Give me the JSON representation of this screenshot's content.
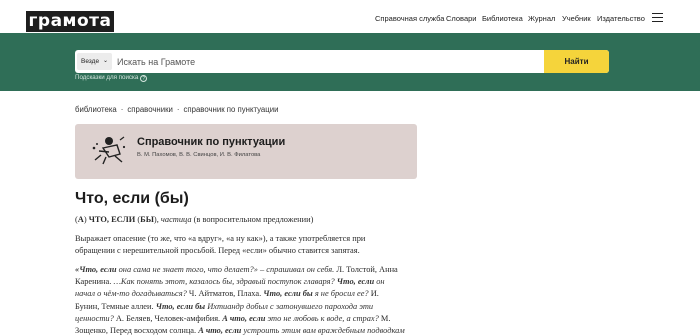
{
  "header": {
    "logo": "грамота",
    "nav": [
      "Справочная служба",
      "Словари",
      "Библиотека",
      "Журнал",
      "Учебник",
      "Издательство"
    ]
  },
  "search": {
    "scope": "Везде",
    "placeholder": "Искать на Грамоте",
    "button": "Найти",
    "hints": "Подсказки для поиска"
  },
  "breadcrumb": [
    "библиотека",
    "справочники",
    "справочник по пунктуации"
  ],
  "card": {
    "title": "Справочник по пунктуации",
    "authors": "В. М. Пахомов, В. В. Свинцов, И. В. Филатова"
  },
  "article": {
    "title": "Что, если (бы)",
    "def": {
      "a": "А",
      "words": "ЧТО, ЕСЛИ",
      "by": "БЫ",
      "pos": "частица",
      "note": "(в вопросительном предложении)"
    },
    "para1": "Выражает опасение (то же, что «а вдруг», «а ну как»), а также употребляется при обращении с нерешительной просьбой. Перед «если» обычно ставится запятая.",
    "examples": [
      {
        "b": "«Что, если",
        "i": " она сама не знает того, что делает?» – спрашивал он себя.",
        "r": " Л. Толстой, Анна Каренина. "
      },
      {
        "b": "",
        "i": "…Как понять этот, казалось бы, здравый поступок главаря? ",
        "r": ""
      },
      {
        "b": "Что, если",
        "i": " он начал о чём-то догадываться?",
        "r": " Ч. Айтматов, Плаха. "
      },
      {
        "b": "Что, если бы",
        "i": " я не бросил ее?",
        "r": " И. Бунин, Темные аллеи. "
      },
      {
        "b": "Что, если бы",
        "i": " Ихтиандр добыл с затонувшего парохода эти ценности?",
        "r": " А. Беляев, Человек-амфибия. "
      },
      {
        "b": "А что, если",
        "i": " это не любовь к воде, а страх?",
        "r": " М. Зощенко, Перед восходом солнца. "
      },
      {
        "b": "А что, если",
        "i": " устроить этим вам враждебным подводкам маленькую ответную",
        "r": ""
      }
    ]
  },
  "colors": {
    "band": "#2f6e57",
    "button": "#f5d43b",
    "card": "#ddd1cf",
    "logo_bg": "#1e1e1e"
  }
}
